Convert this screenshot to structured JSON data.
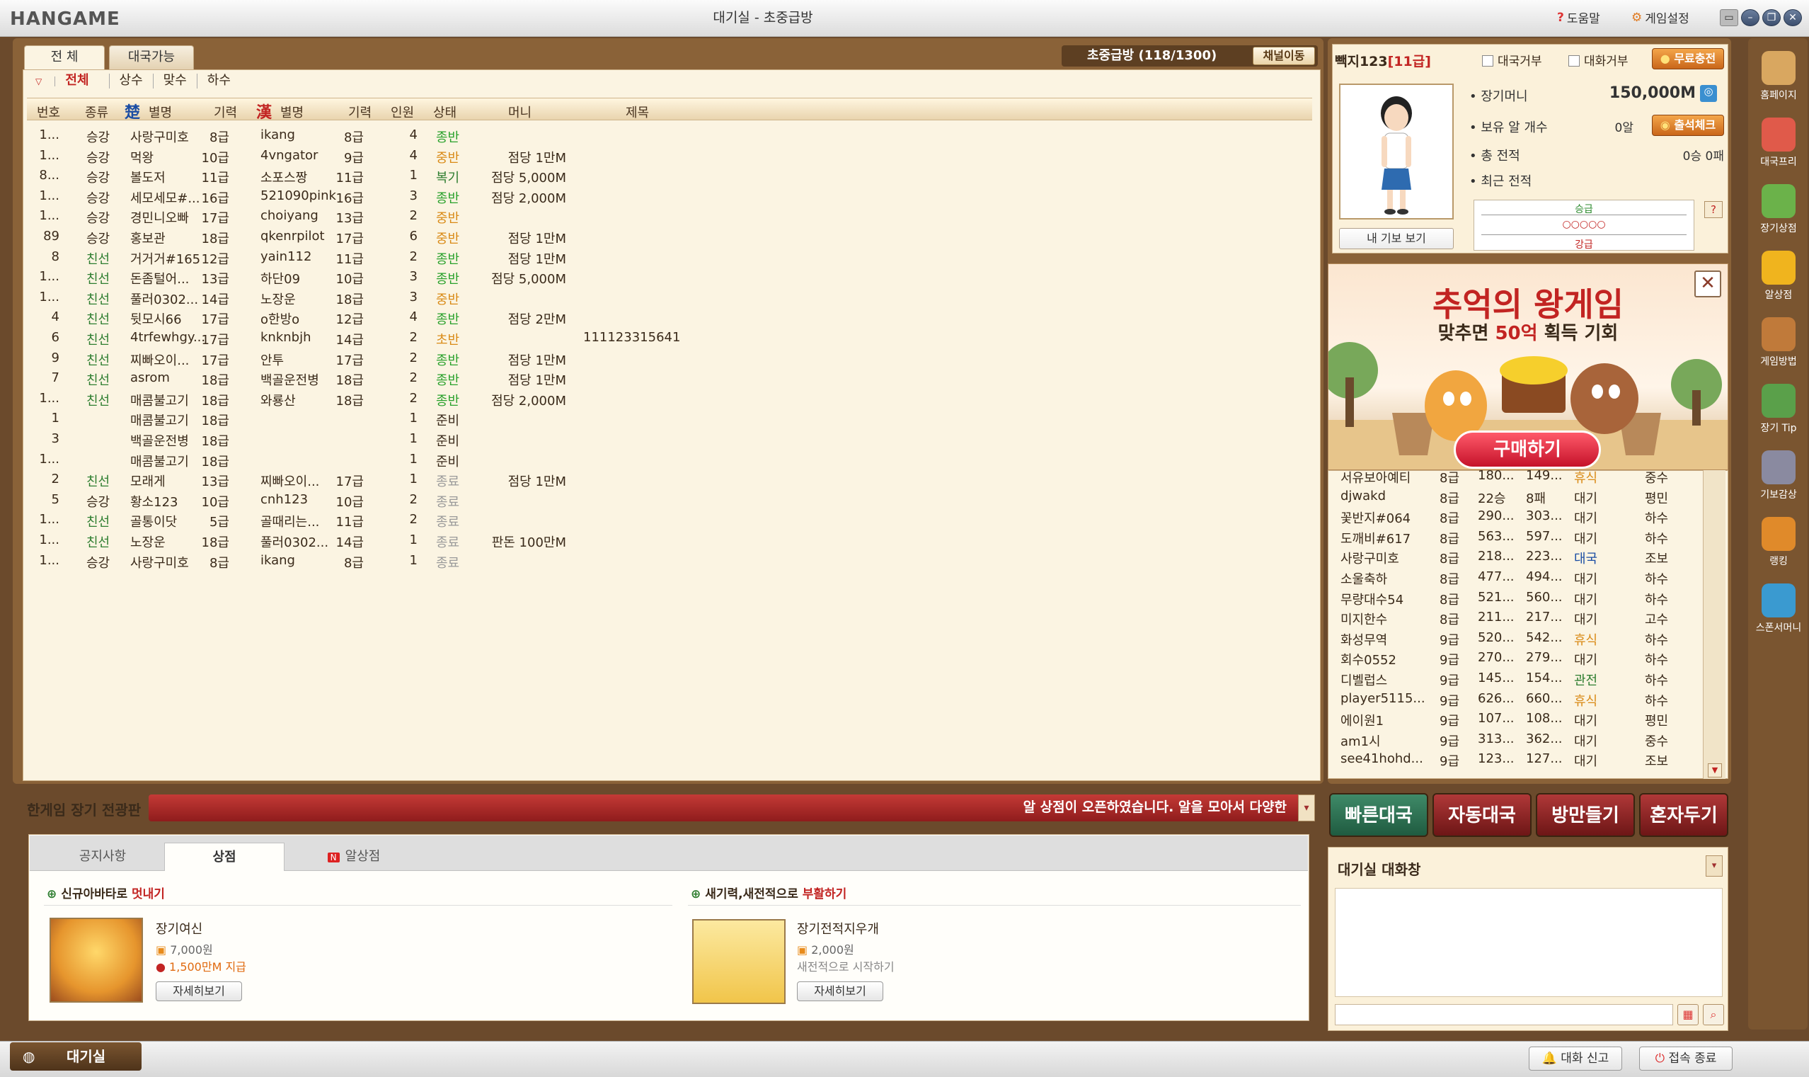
{
  "window": {
    "logo": "HANGAME",
    "title": "대기실 - 초중급방",
    "help": "도움말",
    "settings": "게임설정"
  },
  "tabs": {
    "all": "전 체",
    "match": "대국가능"
  },
  "room": {
    "name": "초중급방 (118/1300)",
    "channel_btn": "채널이동"
  },
  "filters": [
    "전체",
    "상수",
    "맞수",
    "하수"
  ],
  "table_headers": {
    "no": "번호",
    "kind": "종류",
    "cho_glyph": "楚",
    "cho_name": "별명",
    "cho_level": "기력",
    "han_glyph": "漢",
    "han_name": "별명",
    "han_level": "기력",
    "people": "인원",
    "state": "상태",
    "money": "머니",
    "title": "제목"
  },
  "rows": [
    {
      "no": "1...",
      "kind": "승강",
      "n1": "사랑구미호",
      "l1": "8급",
      "n2": "ikang",
      "l2": "8급",
      "p": "4",
      "st": "종반",
      "money": "",
      "title": ""
    },
    {
      "no": "1...",
      "kind": "승강",
      "n1": "먹왕",
      "l1": "10급",
      "n2": "4vngator",
      "l2": "9급",
      "p": "4",
      "st": "중반",
      "money": "점당 1만M",
      "title": ""
    },
    {
      "no": "8...",
      "kind": "승강",
      "n1": "볼도저",
      "l1": "11급",
      "n2": "소포스짱",
      "l2": "11급",
      "p": "1",
      "st": "복기",
      "money": "점당 5,000M",
      "title": ""
    },
    {
      "no": "1...",
      "kind": "승강",
      "n1": "세모세모#...",
      "l1": "16급",
      "n2": "521090pink",
      "l2": "16급",
      "p": "3",
      "st": "종반",
      "money": "점당 2,000M",
      "title": ""
    },
    {
      "no": "1...",
      "kind": "승강",
      "n1": "경민니오빠",
      "l1": "17급",
      "n2": "choiyang",
      "l2": "13급",
      "p": "2",
      "st": "중반",
      "money": "",
      "title": ""
    },
    {
      "no": "89",
      "kind": "승강",
      "n1": "홍보관",
      "l1": "18급",
      "n2": "qkenrpilot",
      "l2": "17급",
      "p": "6",
      "st": "중반",
      "money": "점당 1만M",
      "title": ""
    },
    {
      "no": "8",
      "kind": "친선",
      "n1": "거거거#165",
      "l1": "12급",
      "n2": "yain112",
      "l2": "11급",
      "p": "2",
      "st": "종반",
      "money": "점당 1만M",
      "title": ""
    },
    {
      "no": "1...",
      "kind": "친선",
      "n1": "돈좀털어...",
      "l1": "13급",
      "n2": "하단09",
      "l2": "10급",
      "p": "3",
      "st": "종반",
      "money": "점당 5,000M",
      "title": ""
    },
    {
      "no": "1...",
      "kind": "친선",
      "n1": "풀러0302...",
      "l1": "14급",
      "n2": "노장운",
      "l2": "18급",
      "p": "3",
      "st": "중반",
      "money": "",
      "title": ""
    },
    {
      "no": "4",
      "kind": "친선",
      "n1": "뒷모시66",
      "l1": "17급",
      "n2": "o한방o",
      "l2": "12급",
      "p": "4",
      "st": "종반",
      "money": "점당 2만M",
      "title": ""
    },
    {
      "no": "6",
      "kind": "친선",
      "n1": "4trfewhgy...",
      "l1": "17급",
      "n2": "knknbjh",
      "l2": "14급",
      "p": "2",
      "st": "초반",
      "money": "",
      "title": "111123315641"
    },
    {
      "no": "9",
      "kind": "친선",
      "n1": "찌빠오이...",
      "l1": "17급",
      "n2": "안투",
      "l2": "17급",
      "p": "2",
      "st": "종반",
      "money": "점당 1만M",
      "title": ""
    },
    {
      "no": "7",
      "kind": "친선",
      "n1": "asrom",
      "l1": "18급",
      "n2": "백골운전병",
      "l2": "18급",
      "p": "2",
      "st": "종반",
      "money": "점당 1만M",
      "title": ""
    },
    {
      "no": "1...",
      "kind": "친선",
      "n1": "매콤불고기",
      "l1": "18급",
      "n2": "와룡산",
      "l2": "18급",
      "p": "2",
      "st": "종반",
      "money": "점당 2,000M",
      "title": ""
    },
    {
      "no": "1",
      "kind": "",
      "n1": "매콤불고기",
      "l1": "18급",
      "n2": "",
      "l2": "",
      "p": "1",
      "st": "준비",
      "money": "",
      "title": ""
    },
    {
      "no": "3",
      "kind": "",
      "n1": "백골운전병",
      "l1": "18급",
      "n2": "",
      "l2": "",
      "p": "1",
      "st": "준비",
      "money": "",
      "title": ""
    },
    {
      "no": "1...",
      "kind": "",
      "n1": "매콤불고기",
      "l1": "18급",
      "n2": "",
      "l2": "",
      "p": "1",
      "st": "준비",
      "money": "",
      "title": ""
    },
    {
      "no": "2",
      "kind": "친선",
      "n1": "모래게",
      "l1": "13급",
      "n2": "찌빠오이...",
      "l2": "17급",
      "p": "1",
      "st": "종료",
      "money": "점당 1만M",
      "title": ""
    },
    {
      "no": "5",
      "kind": "승강",
      "n1": "황소123",
      "l1": "10급",
      "n2": "cnh123",
      "l2": "10급",
      "p": "2",
      "st": "종료",
      "money": "",
      "title": ""
    },
    {
      "no": "1...",
      "kind": "친선",
      "n1": "골통이닷",
      "l1": "5급",
      "n2": "골때리는...",
      "l2": "11급",
      "p": "2",
      "st": "종료",
      "money": "",
      "title": ""
    },
    {
      "no": "1...",
      "kind": "친선",
      "n1": "노장운",
      "l1": "18급",
      "n2": "풀러0302...",
      "l2": "14급",
      "p": "1",
      "st": "종료",
      "money": "판돈 100만M",
      "title": ""
    },
    {
      "no": "1...",
      "kind": "승강",
      "n1": "사랑구미호",
      "l1": "8급",
      "n2": "ikang",
      "l2": "8급",
      "p": "1",
      "st": "종료",
      "money": "",
      "title": ""
    }
  ],
  "notice": {
    "label": "한게임 장기 전광판",
    "text": "알 상점이 오픈하였습니다. 알을 모아서 다양한"
  },
  "shop": {
    "tabs": [
      "공지사항",
      "상점",
      "알상점"
    ],
    "new_badge": "N",
    "left_header_a": "신규아바타로 ",
    "left_header_b": "멋내기",
    "right_header_a": "새기력,새전적으로 ",
    "right_header_b": "부활하기",
    "item1": {
      "name": "장기여신",
      "price": "7,000원",
      "bonus": "1,500만M 지급",
      "btn": "자세히보기"
    },
    "item2": {
      "name": "장기전적지우개",
      "price": "2,000원",
      "desc": "새전적으로 시작하기",
      "btn": "자세히보기"
    }
  },
  "profile": {
    "name": "빽지123",
    "level": "[11급]",
    "reject_game": "대국거부",
    "reject_chat": "대화거부",
    "charge": "무료충전",
    "money_label": "장기머니",
    "money": "150,000M",
    "eggs_label": "보유 알 개수",
    "eggs": "0알",
    "attend": "출석체크",
    "total_label": "총 전적",
    "total": "0승 0패",
    "recent_label": "최근 전적",
    "my_gibo": "내 기보 보기",
    "graph_top": "승급",
    "graph_bottom": "강급",
    "q": "?"
  },
  "ad": {
    "title_a": "추억의 ",
    "title_b": "왕게임",
    "sub_a": "맞추면 ",
    "sub_b": "50억",
    "sub_c": " 획득 기회",
    "buy": "구매하기",
    "close": "✕"
  },
  "users": [
    {
      "n": "서유보아예티",
      "l": "8급",
      "a": "180...",
      "b": "149...",
      "s": "휴식",
      "r": "중수"
    },
    {
      "n": "djwakd",
      "l": "8급",
      "a": "22승",
      "b": "8패",
      "s": "대기",
      "r": "평민"
    },
    {
      "n": "꽃반지#064",
      "l": "8급",
      "a": "290...",
      "b": "303...",
      "s": "대기",
      "r": "하수"
    },
    {
      "n": "도깨비#617",
      "l": "8급",
      "a": "563...",
      "b": "597...",
      "s": "대기",
      "r": "하수"
    },
    {
      "n": "사랑구미호",
      "l": "8급",
      "a": "218...",
      "b": "223...",
      "s": "대국",
      "r": "조보"
    },
    {
      "n": "소울축하",
      "l": "8급",
      "a": "477...",
      "b": "494...",
      "s": "대기",
      "r": "하수"
    },
    {
      "n": "무량대수54",
      "l": "8급",
      "a": "521...",
      "b": "560...",
      "s": "대기",
      "r": "하수"
    },
    {
      "n": "미지한수",
      "l": "8급",
      "a": "211...",
      "b": "217...",
      "s": "대기",
      "r": "고수"
    },
    {
      "n": "화성무역",
      "l": "9급",
      "a": "520...",
      "b": "542...",
      "s": "휴식",
      "r": "하수"
    },
    {
      "n": "회수0552",
      "l": "9급",
      "a": "270...",
      "b": "279...",
      "s": "대기",
      "r": "하수"
    },
    {
      "n": "디벨럽스",
      "l": "9급",
      "a": "145...",
      "b": "154...",
      "s": "관전",
      "r": "하수"
    },
    {
      "n": "player5115...",
      "l": "9급",
      "a": "626...",
      "b": "660...",
      "s": "휴식",
      "r": "하수"
    },
    {
      "n": "에이원1",
      "l": "9급",
      "a": "107...",
      "b": "108...",
      "s": "대기",
      "r": "평민"
    },
    {
      "n": "am1시",
      "l": "9급",
      "a": "313...",
      "b": "362...",
      "s": "대기",
      "r": "중수"
    },
    {
      "n": "see41hohd...",
      "l": "9급",
      "a": "123...",
      "b": "127...",
      "s": "대기",
      "r": "조보"
    }
  ],
  "actions": {
    "quick": "빠른대국",
    "auto": "자동대국",
    "make": "방만들기",
    "solo": "혼자두기"
  },
  "chat": {
    "title": "대기실 대화창"
  },
  "sidebar": [
    {
      "l": "홈페이지"
    },
    {
      "l": "대국프리"
    },
    {
      "l": "장기상점"
    },
    {
      "l": "알상점"
    },
    {
      "l": "게임방법"
    },
    {
      "l": "장기 Tip"
    },
    {
      "l": "기보감상"
    },
    {
      "l": "랭킹"
    },
    {
      "l": "스폰서머니"
    }
  ],
  "statusbar": {
    "lobby": "대기실",
    "report": "대화 신고",
    "exit": "접속 종료"
  },
  "colors": {
    "frame": "#8a6238",
    "panel": "#fbf4e2",
    "accent_red": "#c22422",
    "status_green": "#29a12b",
    "status_orange": "#d98a16"
  }
}
